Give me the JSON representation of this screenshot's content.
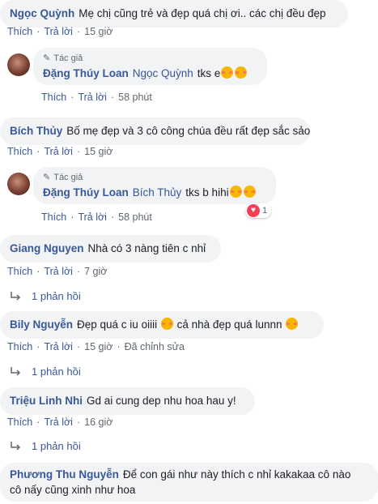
{
  "comments": [
    {
      "name": "Ngọc Quỳnh",
      "text": "Mẹ chị cũng trẻ và đẹp quá chị ơi.. các chị đều đẹp",
      "like": "Thích",
      "reply": "Trả lời",
      "time": "15 giờ"
    },
    {
      "author_badge": "Tác giả",
      "name": "Đặng Thúy Loan",
      "tag": "Ngọc Quỳnh",
      "text": "tks e",
      "like": "Thích",
      "reply": "Trả lời",
      "time": "58 phút",
      "emoji": [
        "smiling-face-with-hearts",
        "smiling-face-with-hearts"
      ]
    },
    {
      "name": "Bích Thủy",
      "text": "Bố mẹ đẹp và 3 cô công chúa đều rất đẹp sắc sảo",
      "like": "Thích",
      "reply": "Trả lời",
      "time": "15 giờ"
    },
    {
      "author_badge": "Tác giả",
      "name": "Đặng Thúy Loan",
      "tag": "Bích Thủy",
      "text": "tks b hihi",
      "like": "Thích",
      "reply": "Trả lời",
      "time": "58 phút",
      "reaction_count": "1",
      "emoji": [
        "kissing-face",
        "kissing-face"
      ]
    },
    {
      "name": "Giang Nguyen",
      "text": "Nhà có 3 nàng tiên c nhỉ",
      "like": "Thích",
      "reply": "Trả lời",
      "time": "7 giờ",
      "replies": "1 phản hồi"
    },
    {
      "name": "Bily Nguyễn",
      "text": "Đẹp quá c iu oiiii",
      "text2": "cả nhà đẹp quá lunnn",
      "like": "Thích",
      "reply": "Trả lời",
      "time": "15 giờ",
      "edited": "Đã chỉnh sửa",
      "replies": "1 phản hồi"
    },
    {
      "name": "Triệu Linh Nhi",
      "text": "Gd ai cung dep nhu hoa hau y!",
      "like": "Thích",
      "reply": "Trả lời",
      "time": "16 giờ",
      "replies": "1 phản hồi"
    },
    {
      "name": "Phương Thu Nguyễn",
      "text": "Để con gái như này thích c nhỉ kakakaa cô nào",
      "text_line2": "cô nấy cũng xinh như hoa"
    }
  ],
  "colors": {
    "link": "#385898",
    "bubble": "#f2f3f5",
    "meta": "#606770",
    "heart": "#f33e58"
  }
}
